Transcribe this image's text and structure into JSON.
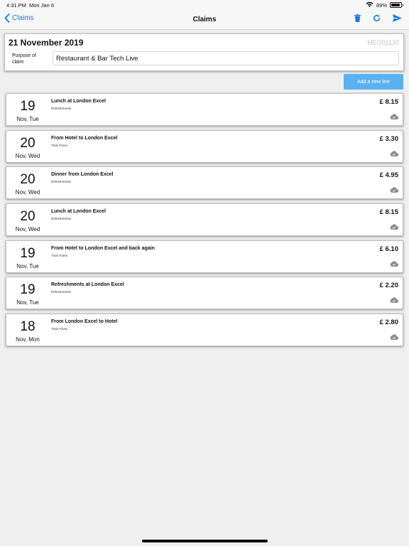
{
  "status_bar": {
    "time": "4:31 PM",
    "date": "Mon Jan 6",
    "battery": "89%",
    "battery_level": 0.89
  },
  "nav": {
    "back_label": "Claims",
    "title": "Claims",
    "actions": [
      "trash-icon",
      "refresh-icon",
      "send-icon"
    ]
  },
  "claim": {
    "date": "21 November 2019",
    "reference": "MEO01130",
    "purpose_label": "Purpose of claim",
    "purpose_value": "Restaurant & Bar Tech Live"
  },
  "add_line_label": "Add a new line",
  "lines": [
    {
      "day": "19",
      "month": "Nov, Tue",
      "title": "Lunch at London Excel",
      "category": "Refreshments",
      "amount": "£ 8.15"
    },
    {
      "day": "20",
      "month": "Nov, Wed",
      "title": "From Hotel to London Excel",
      "category": "Train Fares",
      "amount": "£ 3.30"
    },
    {
      "day": "20",
      "month": "Nov, Wed",
      "title": "Dinner from London Excel",
      "category": "Refreshments",
      "amount": "£ 4.95"
    },
    {
      "day": "20",
      "month": "Nov, Wed",
      "title": "Lunch at London Excel",
      "category": "Refreshments",
      "amount": "£ 8.15"
    },
    {
      "day": "19",
      "month": "Nov, Tue",
      "title": "From Hotel to London Excel and back again",
      "category": "Train Fares",
      "amount": "£ 6.10"
    },
    {
      "day": "19",
      "month": "Nov, Tue",
      "title": "Refreshments at London Excel",
      "category": "Refreshments",
      "amount": "£ 2.20"
    },
    {
      "day": "18",
      "month": "Nov, Mon",
      "title": "From London Excel to Hotel",
      "category": "Train Fares",
      "amount": "£ 2.80"
    }
  ],
  "colors": {
    "accent": "#1877e6",
    "button": "#5ab1ef",
    "background": "#efeff0"
  }
}
